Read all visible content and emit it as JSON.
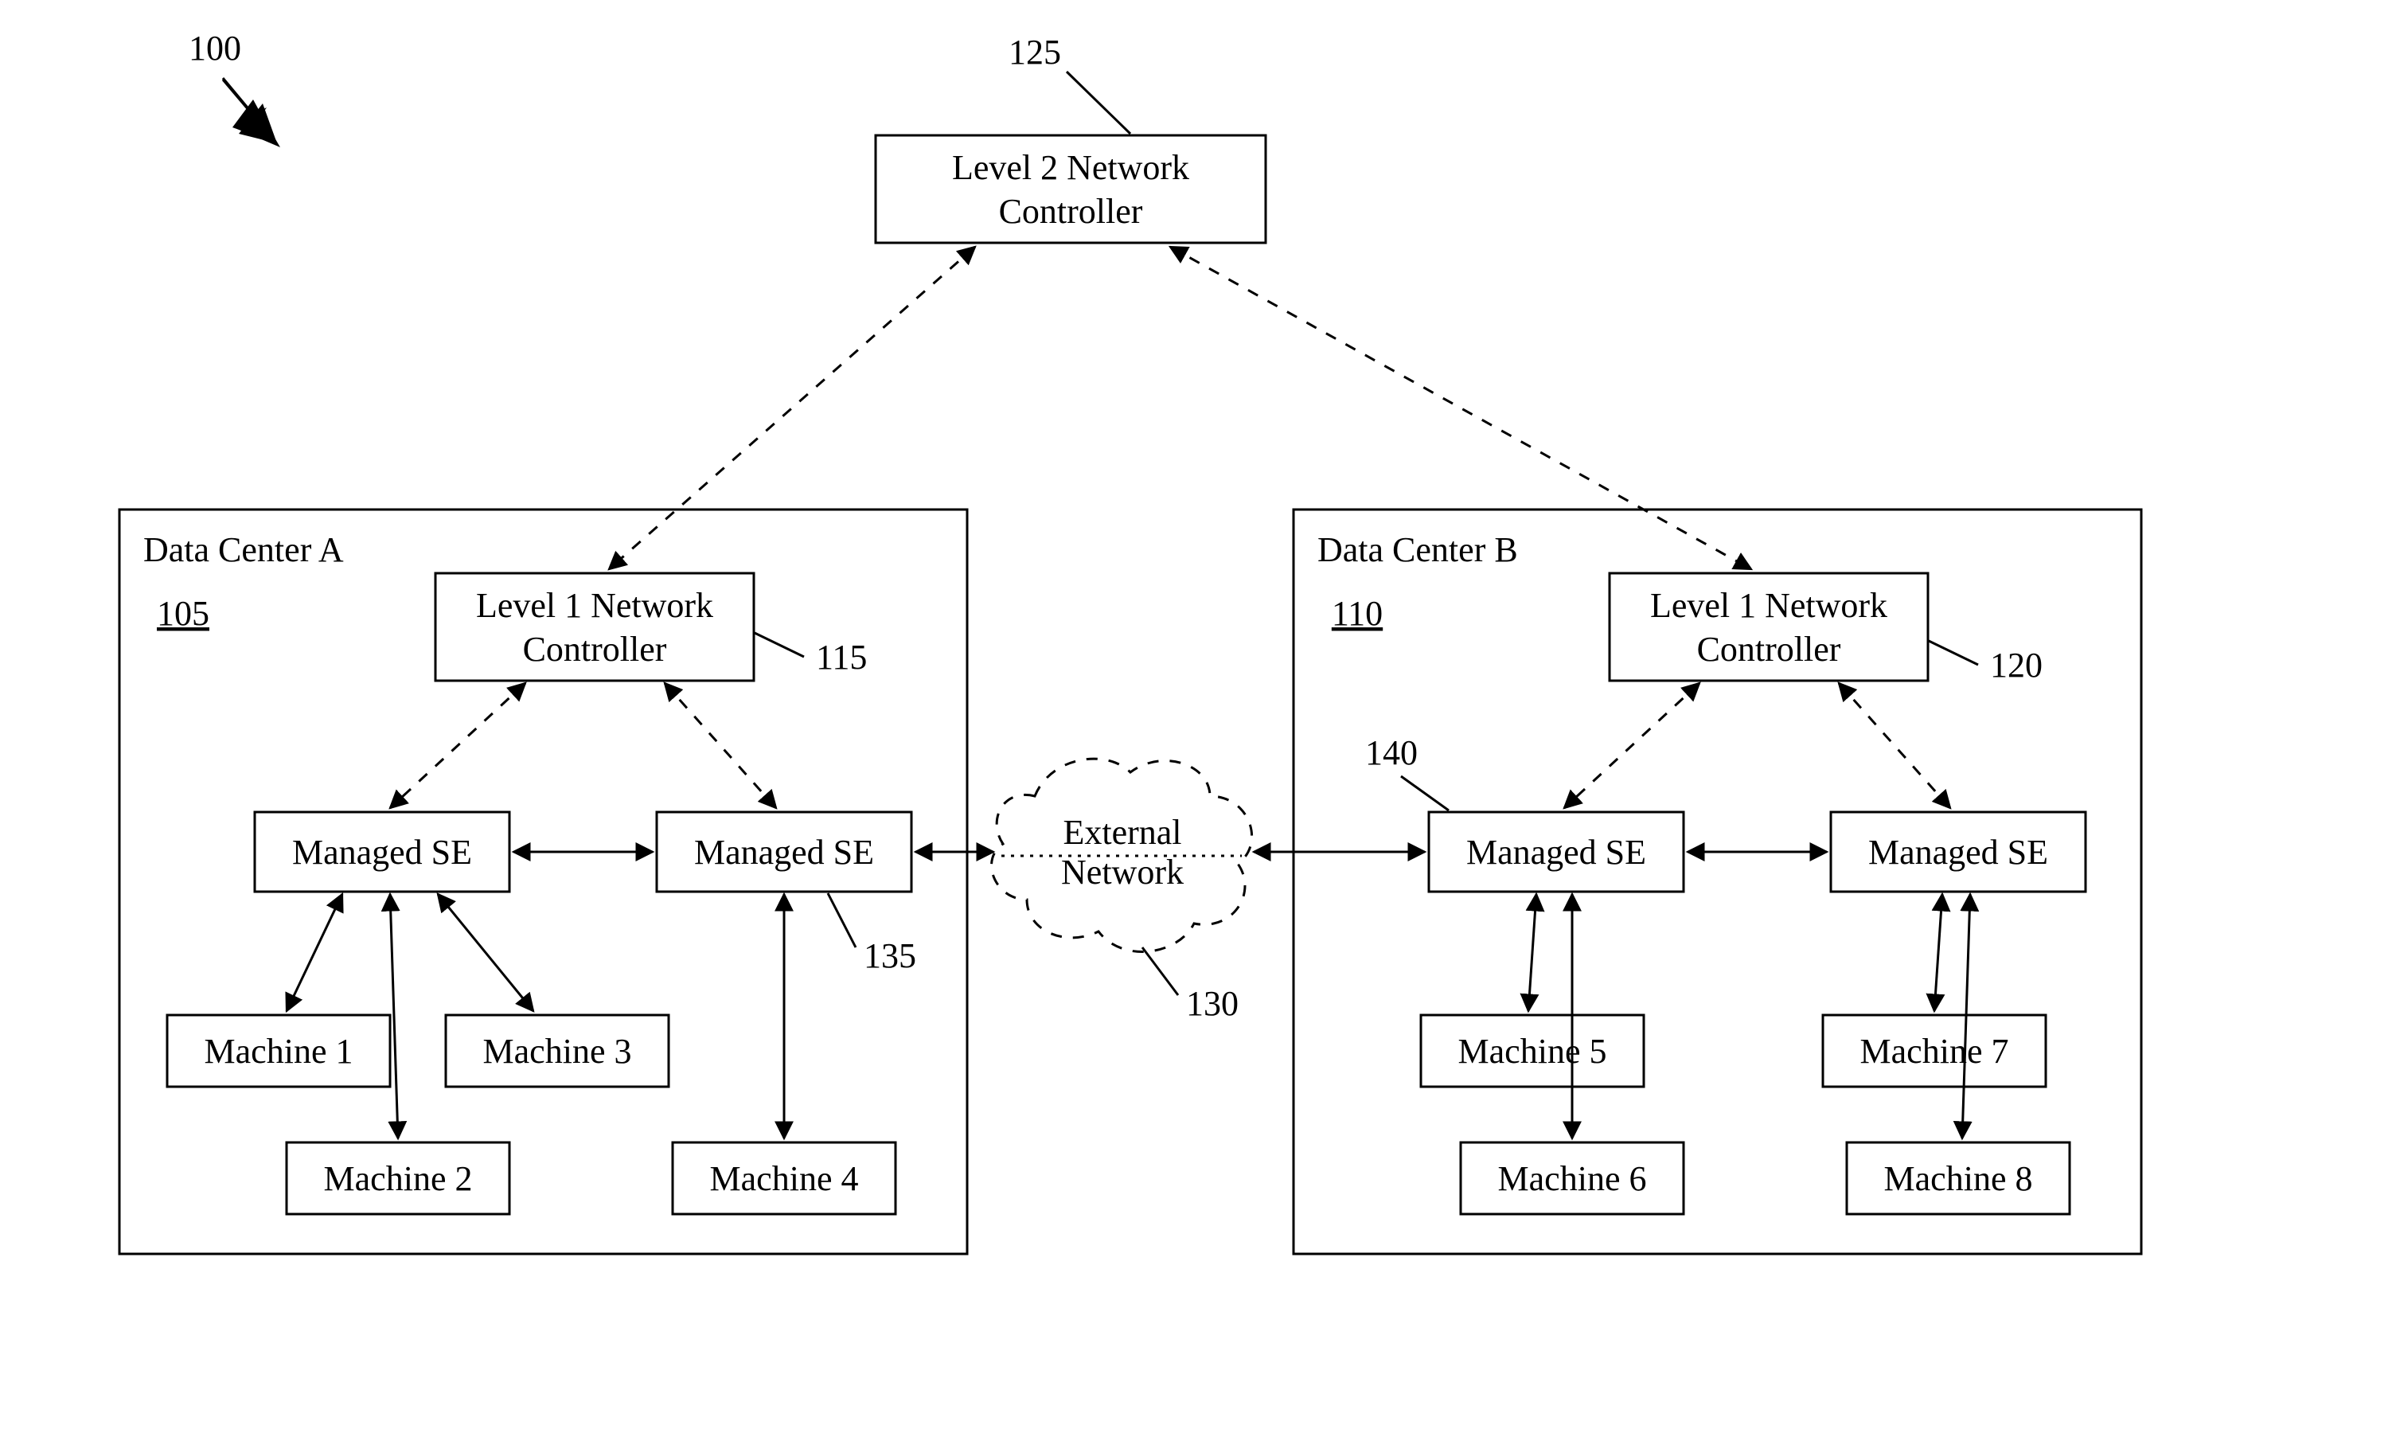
{
  "figure": {
    "ref100": "100",
    "ref125": "125",
    "ref105": "105",
    "ref110": "110",
    "ref115": "115",
    "ref120": "120",
    "ref130": "130",
    "ref135": "135",
    "ref140": "140",
    "l2controller_l1": "Level 2 Network",
    "l2controller_l2": "Controller",
    "l1controller_l1": "Level 1 Network",
    "l1controller_l2": "Controller",
    "dcA": "Data Center A",
    "dcB": "Data Center B",
    "se": "Managed SE",
    "ext_l1": "External",
    "ext_l2": "Network",
    "m1": "Machine 1",
    "m2": "Machine 2",
    "m3": "Machine 3",
    "m4": "Machine 4",
    "m5": "Machine 5",
    "m6": "Machine 6",
    "m7": "Machine 7",
    "m8": "Machine 8"
  }
}
